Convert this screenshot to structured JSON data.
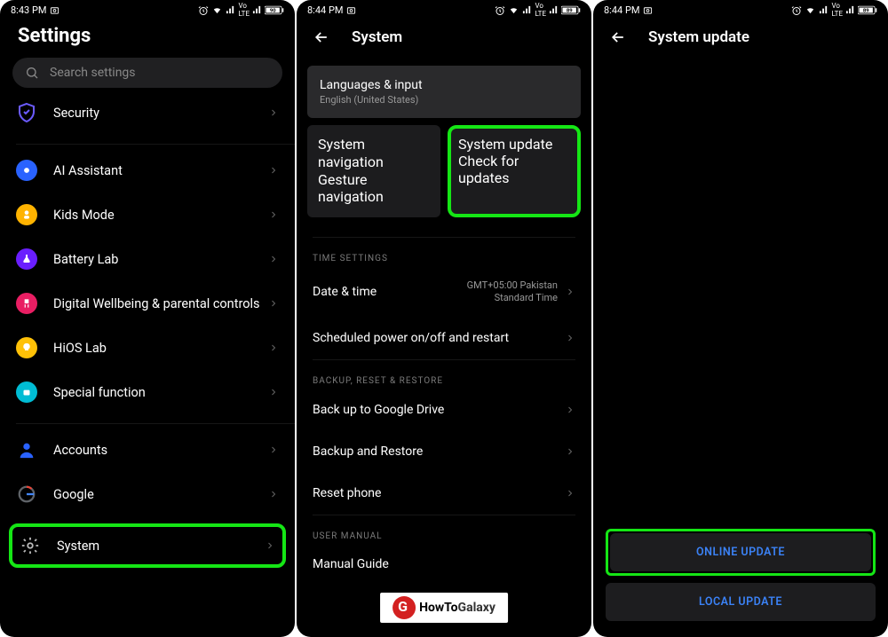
{
  "statusbar": {
    "time1": "8:43 PM",
    "time2": "8:44 PM",
    "time3": "8:44 PM",
    "battery": "89"
  },
  "s1": {
    "title": "Settings",
    "searchPlaceholder": "Search settings",
    "items": [
      {
        "label": "Security"
      },
      {
        "label": "AI Assistant"
      },
      {
        "label": "Kids Mode"
      },
      {
        "label": "Battery Lab"
      },
      {
        "label": "Digital Wellbeing & parental controls"
      },
      {
        "label": "HiOS Lab"
      },
      {
        "label": "Special function"
      },
      {
        "label": "Accounts"
      },
      {
        "label": "Google"
      },
      {
        "label": "System"
      }
    ]
  },
  "s2": {
    "title": "System",
    "cards": {
      "lang": {
        "title": "Languages & input",
        "sub": "English (United States)"
      },
      "nav": {
        "title": "System navigation",
        "sub": "Gesture navigation"
      },
      "upd": {
        "title": "System update",
        "sub": "Check for updates"
      }
    },
    "sections": {
      "time": "TIME SETTINGS",
      "backup": "BACKUP, RESET & RESTORE",
      "manual": "USER MANUAL"
    },
    "rows": {
      "date": {
        "label": "Date & time",
        "val": "GMT+05:00 Pakistan Standard Time"
      },
      "sched": {
        "label": "Scheduled power on/off and restart"
      },
      "gdrive": {
        "label": "Back up to Google Drive"
      },
      "brestore": {
        "label": "Backup and Restore"
      },
      "reset": {
        "label": "Reset phone"
      },
      "guide": {
        "label": "Manual Guide"
      }
    }
  },
  "s3": {
    "title": "System update",
    "online": "ONLINE UPDATE",
    "local": "LOCAL UPDATE"
  },
  "watermark": {
    "text1": "HowTo",
    "text2": "Galaxy"
  }
}
